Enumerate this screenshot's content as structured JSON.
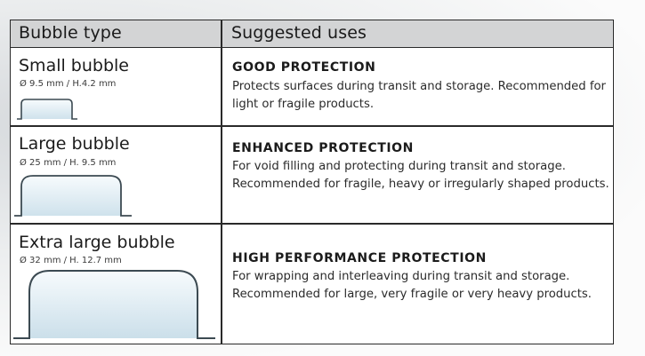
{
  "table": {
    "headers": {
      "bubble_type": "Bubble type",
      "suggested_uses": "Suggested uses"
    },
    "rows": [
      {
        "title": "Small bubble",
        "dimensions": "Ø 9.5 mm / H.4.2 mm",
        "icon": "small-bubble-icon",
        "heading": "GOOD PROTECTION",
        "description": "Protects surfaces during transit and storage. Recommended for light or fragile products."
      },
      {
        "title": "Large bubble",
        "dimensions": "Ø 25 mm / H. 9.5 mm",
        "icon": "large-bubble-icon",
        "heading": "ENHANCED PROTECTION",
        "description": "For void filling and protecting during transit and storage. Recommended for fragile, heavy or irregularly shaped products."
      },
      {
        "title": "Extra large bubble",
        "dimensions": "Ø 32 mm / H. 12.7 mm",
        "icon": "extra-large-bubble-icon",
        "heading": "HIGH PERFORMANCE PROTECTION",
        "description": "For wrapping and interleaving during transit and storage. Recommended for large, very fragile or very heavy products."
      }
    ]
  },
  "colors": {
    "header_background": "#d3d4d5",
    "border": "#2a2a2a",
    "bubble_fill": "#e6f1f6",
    "bubble_stroke": "#3c4a52"
  }
}
